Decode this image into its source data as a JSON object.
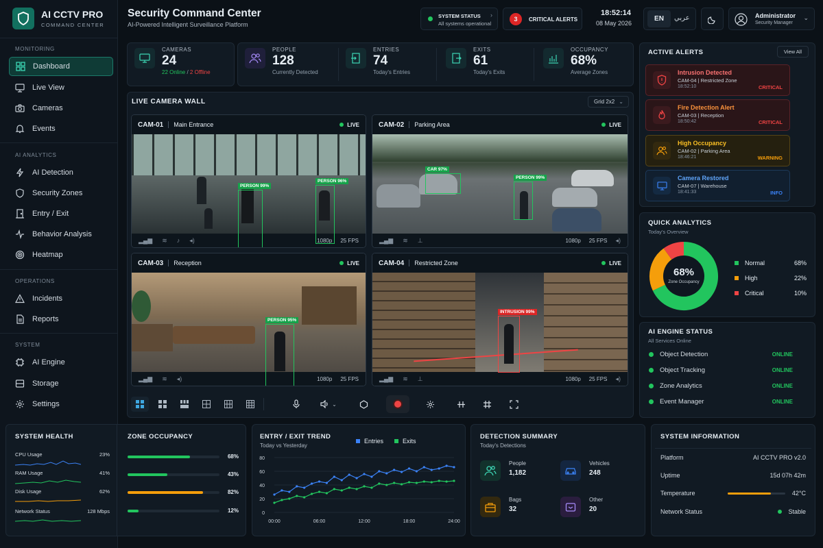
{
  "brand": {
    "name": "AI CCTV PRO",
    "subtitle": "COMMAND CENTER"
  },
  "sidebar": {
    "sections": [
      {
        "title": "MONITORING",
        "items": [
          {
            "label": "Dashboard",
            "icon": "grid-icon",
            "active": true
          },
          {
            "label": "Live View",
            "icon": "monitor-icon"
          },
          {
            "label": "Cameras",
            "icon": "camera-icon"
          },
          {
            "label": "Events",
            "icon": "bell-icon"
          }
        ]
      },
      {
        "title": "AI ANALYTICS",
        "items": [
          {
            "label": "AI Detection",
            "icon": "bolt-icon"
          },
          {
            "label": "Security Zones",
            "icon": "shield-icon"
          },
          {
            "label": "Entry / Exit",
            "icon": "door-icon"
          },
          {
            "label": "Behavior Analysis",
            "icon": "pulse-icon"
          },
          {
            "label": "Heatmap",
            "icon": "target-icon"
          }
        ]
      },
      {
        "title": "OPERATIONS",
        "items": [
          {
            "label": "Incidents",
            "icon": "warning-icon"
          },
          {
            "label": "Reports",
            "icon": "document-icon"
          }
        ]
      },
      {
        "title": "SYSTEM",
        "items": [
          {
            "label": "AI Engine",
            "icon": "cpu-icon"
          },
          {
            "label": "Storage",
            "icon": "storage-icon"
          },
          {
            "label": "Settings",
            "icon": "gear-icon"
          }
        ]
      }
    ]
  },
  "header": {
    "title": "Security Command Center",
    "subtitle": "AI-Powered Intelligent Surveillance Platform",
    "system_status": {
      "label": "SYSTEM STATUS",
      "value": "All systems operational"
    },
    "critical": {
      "count": "3",
      "label": "CRITICAL ALERTS"
    },
    "time": "18:52:14",
    "date": "08 May 2026",
    "lang_en": "EN",
    "lang_ar": "عربي",
    "user": {
      "name": "Administrator",
      "role": "Security Manager"
    }
  },
  "kpis": [
    {
      "label": "CAMERAS",
      "value": "24",
      "sub_online": "22 Online",
      "sub_sep": " / ",
      "sub_offline": "2 Offline"
    },
    {
      "label": "PEOPLE",
      "value": "128",
      "sub": "Currently Detected"
    },
    {
      "label": "ENTRIES",
      "value": "74",
      "sub": "Today's Entries"
    },
    {
      "label": "EXITS",
      "value": "61",
      "sub": "Today's Exits"
    },
    {
      "label": "OCCUPANCY",
      "value": "68%",
      "sub": "Average Zones"
    }
  ],
  "camera_wall": {
    "title": "LIVE CAMERA WALL",
    "layout": "Grid 2x2",
    "cams": [
      {
        "id": "CAM-01",
        "name": "Main Entrance",
        "live": "LIVE",
        "res": "1080p",
        "fps": "25 FPS",
        "labels": [
          "PERSON 99%",
          "PERSON 96%"
        ]
      },
      {
        "id": "CAM-02",
        "name": "Parking Area",
        "live": "LIVE",
        "res": "1080p",
        "fps": "25 FPS",
        "labels": [
          "CAR 97%",
          "PERSON 99%"
        ]
      },
      {
        "id": "CAM-03",
        "name": "Reception",
        "live": "LIVE",
        "res": "1080p",
        "fps": "25 FPS",
        "labels": [
          "PERSON 95%"
        ]
      },
      {
        "id": "CAM-04",
        "name": "Restricted Zone",
        "live": "LIVE",
        "res": "1080p",
        "fps": "25 FPS",
        "labels": [
          "INTRUSION 99%"
        ]
      }
    ]
  },
  "alerts": {
    "title": "ACTIVE ALERTS",
    "view_all": "View All",
    "items": [
      {
        "title": "Intrusion Detected",
        "detail": "CAM-04 | Restricted Zone",
        "time": "18:52:10",
        "severity": "CRITICAL",
        "color": "#ef4444"
      },
      {
        "title": "Fire Detection Alert",
        "detail": "CAM-03 | Reception",
        "time": "18:50:42",
        "severity": "CRITICAL",
        "color": "#ef4444"
      },
      {
        "title": "High Occupancy",
        "detail": "CAM-02 | Parking Area",
        "time": "18:46:21",
        "severity": "WARNING",
        "color": "#f59e0b"
      },
      {
        "title": "Camera Restored",
        "detail": "CAM-07 | Warehouse",
        "time": "18:41:33",
        "severity": "INFO",
        "color": "#3b82f6"
      }
    ]
  },
  "quick_analytics": {
    "title": "QUICK ANALYTICS",
    "subtitle": "Today's Overview",
    "center_value": "68%",
    "center_label": "Zone Occupancy",
    "chart_data": {
      "type": "pie",
      "categories": [
        "Normal",
        "High",
        "Critical"
      ],
      "values": [
        68,
        22,
        10
      ],
      "colors": [
        "#22c55e",
        "#f59e0b",
        "#ef4444"
      ]
    },
    "legend": [
      {
        "label": "Normal",
        "value": "68%"
      },
      {
        "label": "High",
        "value": "22%"
      },
      {
        "label": "Critical",
        "value": "10%"
      }
    ]
  },
  "ai_engine": {
    "title": "AI ENGINE STATUS",
    "subtitle": "All Services Online",
    "items": [
      {
        "label": "Object Detection",
        "status": "ONLINE"
      },
      {
        "label": "Object Tracking",
        "status": "ONLINE"
      },
      {
        "label": "Zone Analytics",
        "status": "ONLINE"
      },
      {
        "label": "Event Manager",
        "status": "ONLINE"
      }
    ]
  },
  "system_health": {
    "title": "SYSTEM HEALTH",
    "rows": [
      {
        "label": "CPU Usage",
        "value": "23%"
      },
      {
        "label": "RAM Usage",
        "value": "41%"
      },
      {
        "label": "Disk Usage",
        "value": "62%"
      },
      {
        "label": "Network Status",
        "value": "128 Mbps"
      }
    ]
  },
  "zone_occupancy": {
    "title": "ZONE OCCUPANCY",
    "rows": [
      {
        "value": 68,
        "label": "68%",
        "color": "#22c55e"
      },
      {
        "value": 43,
        "label": "43%",
        "color": "#22c55e"
      },
      {
        "value": 82,
        "label": "82%",
        "color": "#f59e0b"
      },
      {
        "value": 12,
        "label": "12%",
        "color": "#22c55e"
      }
    ]
  },
  "chart_data": {
    "type": "line",
    "title": "ENTRY / EXIT TREND",
    "subtitle": "Today vs Yesterday",
    "x": [
      "00:00",
      "01:00",
      "02:00",
      "03:00",
      "04:00",
      "05:00",
      "06:00",
      "07:00",
      "08:00",
      "09:00",
      "10:00",
      "11:00",
      "12:00",
      "13:00",
      "14:00",
      "15:00",
      "16:00",
      "17:00",
      "18:00",
      "19:00",
      "20:00",
      "21:00",
      "22:00",
      "23:00",
      "24:00"
    ],
    "xticks": [
      "00:00",
      "06:00",
      "12:00",
      "18:00",
      "24:00"
    ],
    "ylim": [
      0,
      80
    ],
    "yticks": [
      0,
      20,
      40,
      60,
      80
    ],
    "series": [
      {
        "name": "Entries",
        "color": "#3b82f6",
        "values": [
          26,
          32,
          30,
          38,
          36,
          42,
          45,
          43,
          52,
          47,
          55,
          50,
          56,
          52,
          60,
          57,
          62,
          59,
          64,
          60,
          66,
          62,
          64,
          68,
          66
        ]
      },
      {
        "name": "Exits",
        "color": "#22c55e",
        "values": [
          14,
          18,
          20,
          24,
          22,
          27,
          30,
          28,
          34,
          32,
          36,
          34,
          38,
          36,
          42,
          40,
          43,
          41,
          44,
          43,
          45,
          44,
          46,
          45,
          46
        ]
      }
    ]
  },
  "detection_summary": {
    "title": "DETECTION SUMMARY",
    "subtitle": "Today's Detections",
    "items": [
      {
        "label": "People",
        "value": "1,182"
      },
      {
        "label": "Vehicles",
        "value": "248"
      },
      {
        "label": "Bags",
        "value": "32"
      },
      {
        "label": "Other",
        "value": "20"
      }
    ]
  },
  "system_info": {
    "title": "SYSTEM INFORMATION",
    "rows": [
      {
        "label": "Platform",
        "value": "AI CCTV PRO v2.0"
      },
      {
        "label": "Uptime",
        "value": "15d 07h 42m"
      },
      {
        "label": "Temperature",
        "value": "42°C",
        "level": 0.75
      },
      {
        "label": "Network Status",
        "value": "Stable"
      }
    ]
  }
}
